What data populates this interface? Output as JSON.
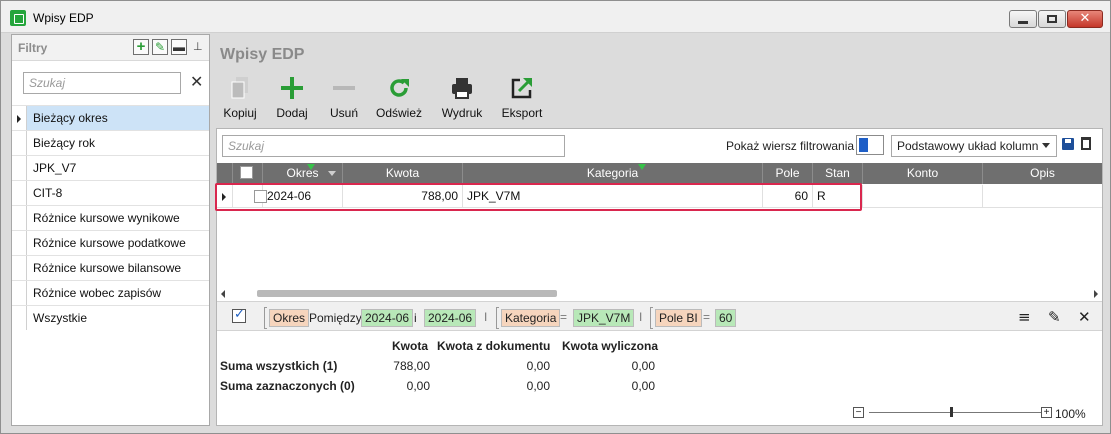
{
  "window": {
    "title": "Wpisy EDP"
  },
  "filters": {
    "title": "Filtry",
    "search_placeholder": "Szukaj",
    "items": [
      {
        "label": "Bieżący okres",
        "active": true
      },
      {
        "label": "Bieżący rok"
      },
      {
        "label": "JPK_V7"
      },
      {
        "label": "CIT-8"
      },
      {
        "label": "Różnice kursowe wynikowe"
      },
      {
        "label": "Różnice kursowe podatkowe"
      },
      {
        "label": "Różnice kursowe bilansowe"
      },
      {
        "label": "Różnice wobec zapisów"
      },
      {
        "label": "Wszystkie"
      }
    ]
  },
  "main": {
    "title": "Wpisy EDP"
  },
  "toolbar": {
    "copy": "Kopiuj",
    "add": "Dodaj",
    "remove": "Usuń",
    "refresh": "Odśwież",
    "print": "Wydruk",
    "export": "Eksport"
  },
  "grid": {
    "search_placeholder": "Szukaj",
    "show_filter_label": "Pokaż wiersz filtrowania",
    "layout_label": "Podstawowy układ kolumn",
    "columns": [
      "Okres",
      "Kwota",
      "Kategoria",
      "Pole",
      "Stan",
      "Konto",
      "Opis"
    ],
    "row": {
      "okres": "2024-06",
      "kwota": "788,00",
      "kategoria": "JPK_V7M",
      "pole": "60",
      "stan": "R",
      "konto": "",
      "opis": ""
    }
  },
  "filter_bar": {
    "field1": "Okres",
    "op1": "Pomiędzy",
    "val1a": "2024-06",
    "and": "i",
    "val1b": "2024-06",
    "sep": "I",
    "field2": "Kategoria",
    "eq": "=",
    "val2": "JPK_V7M",
    "field3": "Pole BI",
    "val3": "60"
  },
  "totals": {
    "headers": [
      "Kwota",
      "Kwota z dokumentu",
      "Kwota wyliczona"
    ],
    "rows": [
      {
        "label": "Suma wszystkich (1)",
        "values": [
          "788,00",
          "0,00",
          "0,00"
        ]
      },
      {
        "label": "Suma zaznaczonych (0)",
        "values": [
          "0,00",
          "0,00",
          "0,00"
        ]
      }
    ]
  },
  "zoom": {
    "value": "100%",
    "minus": "−",
    "plus": "+"
  },
  "icons": {
    "accent_green": "#2a9d36",
    "highlight": "#d9274e"
  }
}
